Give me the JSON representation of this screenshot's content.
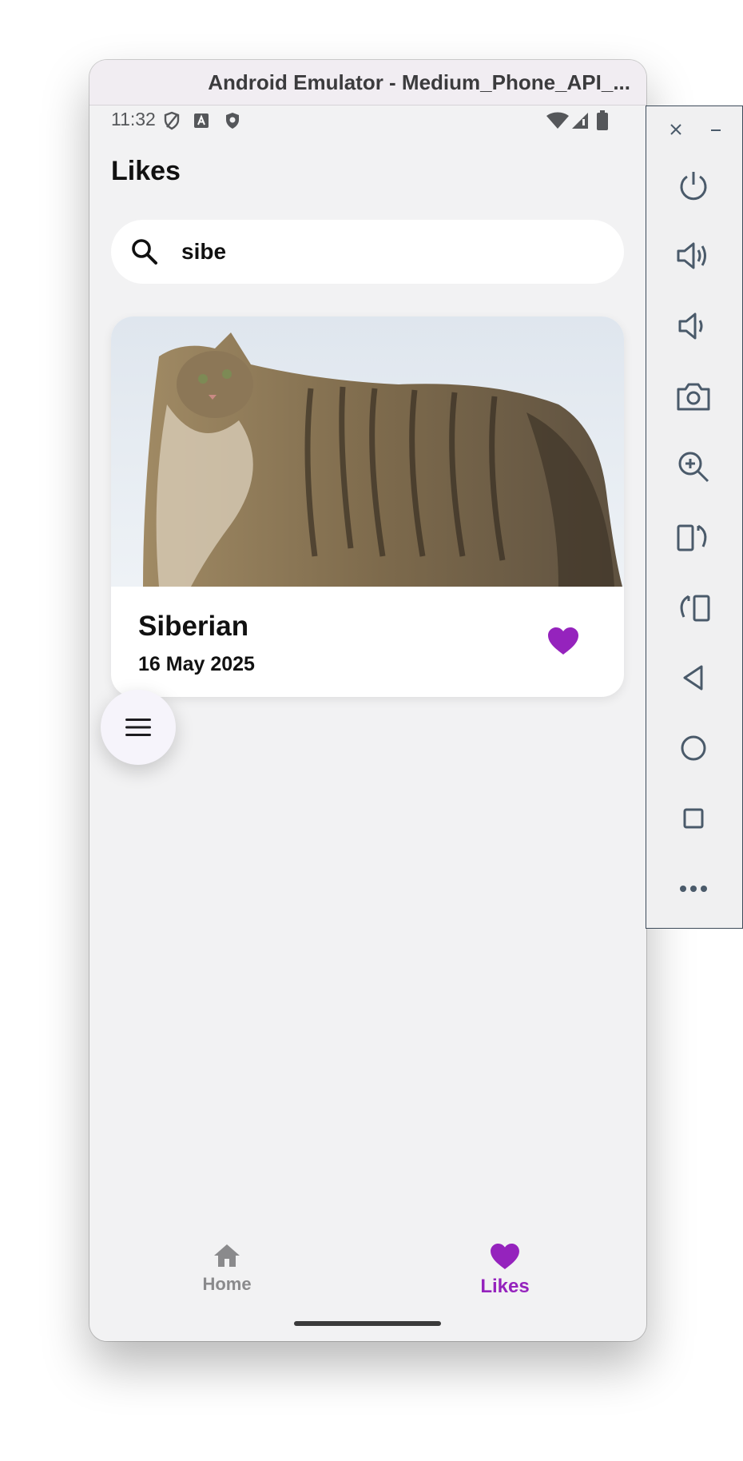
{
  "window": {
    "title": "Android Emulator - Medium_Phone_API_..."
  },
  "status_bar": {
    "time": "11:32",
    "left_icons": [
      "shield-outline-icon",
      "a-box-icon",
      "shield-filled-icon"
    ],
    "right_icons": [
      "wifi-icon",
      "signal-icon",
      "battery-icon"
    ]
  },
  "page": {
    "title": "Likes"
  },
  "search": {
    "value": "sibe",
    "icon": "search-icon"
  },
  "cards": [
    {
      "name": "Siberian",
      "date": "16 May 2025",
      "liked": true,
      "image": "siberian-cat-photo"
    }
  ],
  "fab": {
    "icon": "menu-icon"
  },
  "bottom_nav": {
    "items": [
      {
        "label": "Home",
        "icon": "home-icon",
        "active": false
      },
      {
        "label": "Likes",
        "icon": "heart-icon",
        "active": true
      }
    ]
  },
  "side_panel": {
    "buttons": [
      "close",
      "minimize",
      "power",
      "volume-up",
      "volume-down",
      "camera",
      "zoom",
      "rotate-left",
      "rotate-right",
      "back",
      "home",
      "overview",
      "more"
    ]
  },
  "colors": {
    "accent": "#9523bd",
    "background": "#f2f2f3",
    "card": "#ffffff",
    "inactive": "#8a8a8c"
  }
}
